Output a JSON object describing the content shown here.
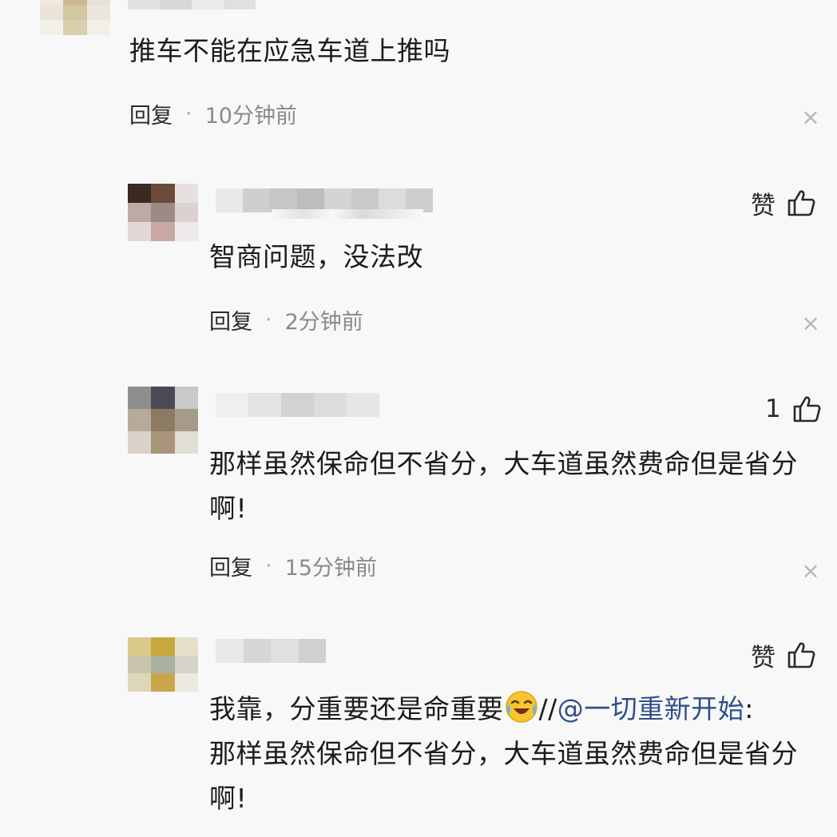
{
  "comments": [
    {
      "text": "推车不能在应急车道上推吗",
      "reply_label": "回复",
      "separator": "·",
      "time": "10分钟前",
      "close_glyph": "×"
    },
    {
      "like_label": "赞",
      "like_icon": "thumbs-up-icon",
      "text": "智商问题，没法改",
      "reply_label": "回复",
      "separator": "·",
      "time": "2分钟前",
      "close_glyph": "×"
    },
    {
      "like_count": "1",
      "like_icon": "thumbs-up-icon",
      "text_line1": "那样虽然保命但不省分，大车道虽然费命但是省分",
      "text_line2": "啊!",
      "reply_label": "回复",
      "separator": "·",
      "time": "15分钟前",
      "close_glyph": "×"
    },
    {
      "like_label": "赞",
      "like_icon": "thumbs-up-icon",
      "text_part1": "我靠，分重要还是命重要",
      "emoji": "laughing-crying-emoji",
      "text_slashes": "//",
      "mention": "@一切重新开始",
      "text_colon": ":",
      "quote_line1": "那样虽然保命但不省分，大车道虽然费命但是省分",
      "quote_line2": "啊!"
    }
  ],
  "colors": {
    "background": "#f8f8f8",
    "text": "#1c1c1c",
    "meta": "#8a8a8a",
    "mention": "#2f4f8a"
  }
}
